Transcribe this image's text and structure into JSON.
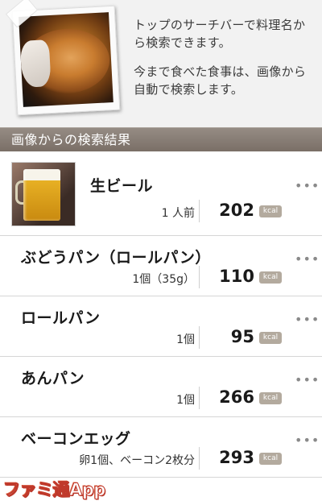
{
  "intro": {
    "line1": "トップのサーチバーで料理名から検索できます。",
    "line2": "今まで食べた食事は、画像から自動で検索します。"
  },
  "section_header": "画像からの検索結果",
  "kcal_unit": "kcal",
  "results": [
    {
      "name": "生ビール",
      "portion": "1 人前",
      "kcal": "202"
    },
    {
      "name": "ぶどうパン（ロールパン）",
      "portion": "1個（35g）",
      "kcal": "110"
    },
    {
      "name": "ロールパン",
      "portion": "1個",
      "kcal": "95"
    },
    {
      "name": "あんパン",
      "portion": "1個",
      "kcal": "266"
    },
    {
      "name": "ベーコンエッグ",
      "portion": "卵1個、ベーコン2枚分",
      "kcal": "293"
    }
  ],
  "watermark": {
    "text": "ファミ通App"
  },
  "icons": {
    "more": "more-dots-icon"
  },
  "colors": {
    "header_bg": "#7f756c",
    "unit_badge": "#b3aa9e"
  }
}
